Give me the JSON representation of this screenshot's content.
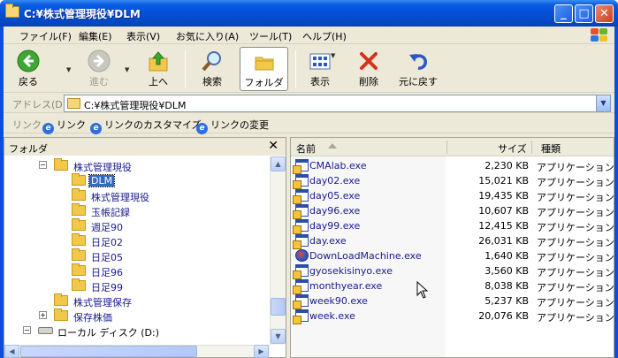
{
  "window": {
    "title": "C:¥株式管理現役¥DLM",
    "min_glyph": "_",
    "max_glyph": "□",
    "close_glyph": "✕"
  },
  "menu": [
    "ファイル(F)",
    "編集(E)",
    "表示(V)",
    "お気に入り(A)",
    "ツール(T)",
    "ヘルプ(H)"
  ],
  "toolbar": {
    "back": "戻る",
    "forward": "進む",
    "up": "上へ",
    "search": "検索",
    "folders": "フォルダ",
    "views": "表示",
    "delete": "削除",
    "undo": "元に戻す"
  },
  "address": {
    "label": "アドレス(D)",
    "value": "C:¥株式管理現役¥DLM"
  },
  "links": {
    "label": "リンク",
    "items": [
      "リンク",
      "リンクのカスタマイズ",
      "リンクの変更"
    ]
  },
  "folder_pane": {
    "title": "フォルダ",
    "close_glyph": "✕",
    "tree": [
      {
        "label": "株式管理現役",
        "expander": "−"
      },
      {
        "label": "DLM",
        "selected": true
      },
      {
        "label": "株式管理現役"
      },
      {
        "label": "玉帳記録"
      },
      {
        "label": "週足90"
      },
      {
        "label": "日足02"
      },
      {
        "label": "日足05"
      },
      {
        "label": "日足96"
      },
      {
        "label": "日足99"
      },
      {
        "label": "株式管理保存"
      },
      {
        "label": "保存株価",
        "expander": "+"
      },
      {
        "label": "ローカル ディスク (D:)",
        "expander": "−"
      }
    ]
  },
  "file_list": {
    "columns": {
      "name": "名前",
      "size": "サイズ",
      "type": "種類"
    },
    "rows": [
      {
        "name": "CMAlab.exe",
        "size": "2,230 KB",
        "type": "アプリケーション"
      },
      {
        "name": "day02.exe",
        "size": "15,021 KB",
        "type": "アプリケーション"
      },
      {
        "name": "day05.exe",
        "size": "19,435 KB",
        "type": "アプリケーション"
      },
      {
        "name": "day96.exe",
        "size": "10,607 KB",
        "type": "アプリケーション"
      },
      {
        "name": "day99.exe",
        "size": "12,415 KB",
        "type": "アプリケーション"
      },
      {
        "name": "day.exe",
        "size": "26,031 KB",
        "type": "アプリケーション"
      },
      {
        "name": "DownLoadMachine.exe",
        "size": "1,640 KB",
        "type": "アプリケーション"
      },
      {
        "name": "gyosekisinyo.exe",
        "size": "3,560 KB",
        "type": "アプリケーション"
      },
      {
        "name": "monthyear.exe",
        "size": "8,038 KB",
        "type": "アプリケーション"
      },
      {
        "name": "week90.exe",
        "size": "5,237 KB",
        "type": "アプリケーション"
      },
      {
        "name": "week.exe",
        "size": "20,076 KB",
        "type": "アプリケーション"
      }
    ]
  }
}
